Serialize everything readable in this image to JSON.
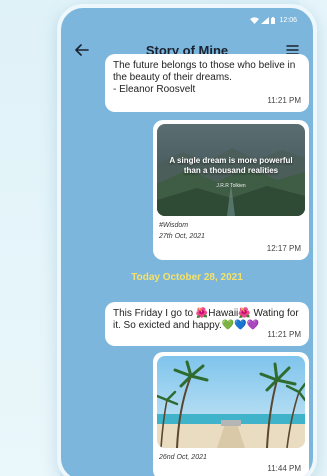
{
  "status_bar": {
    "time": "12:06"
  },
  "app_bar": {
    "title": "Story of Mine"
  },
  "messages": [
    {
      "text": "The future belongs to those who belive in the beauty of their dreams.\n- Eleanor Roosvelt",
      "time": "11:21 PM"
    },
    {
      "image_quote": "A single dream is more powerful than a thousand realities",
      "image_author": "J.R.R Tolkien",
      "caption_tag": "#Wisdom",
      "caption_date": "27th Oct, 2021",
      "time": "12:17 PM"
    },
    {
      "text": "This Friday I go to 🌺Hawaii🌺 Wating for it. So exicted and happy.💚💙💜",
      "time": "11:21 PM"
    },
    {
      "caption_date": "26nd Oct, 2021",
      "time": "11:44 PM"
    }
  ],
  "date_divider": "Today October 28, 2021",
  "colors": {
    "chat_background": "#7cb6dc",
    "bubble": "#ffffff",
    "date_divider": "#f6e26a",
    "title": "#1b2230"
  },
  "icons": {
    "back": "arrow-left-icon",
    "menu": "hamburger-menu-icon",
    "wifi": "wifi-icon",
    "signal": "signal-icon",
    "battery": "battery-icon"
  }
}
